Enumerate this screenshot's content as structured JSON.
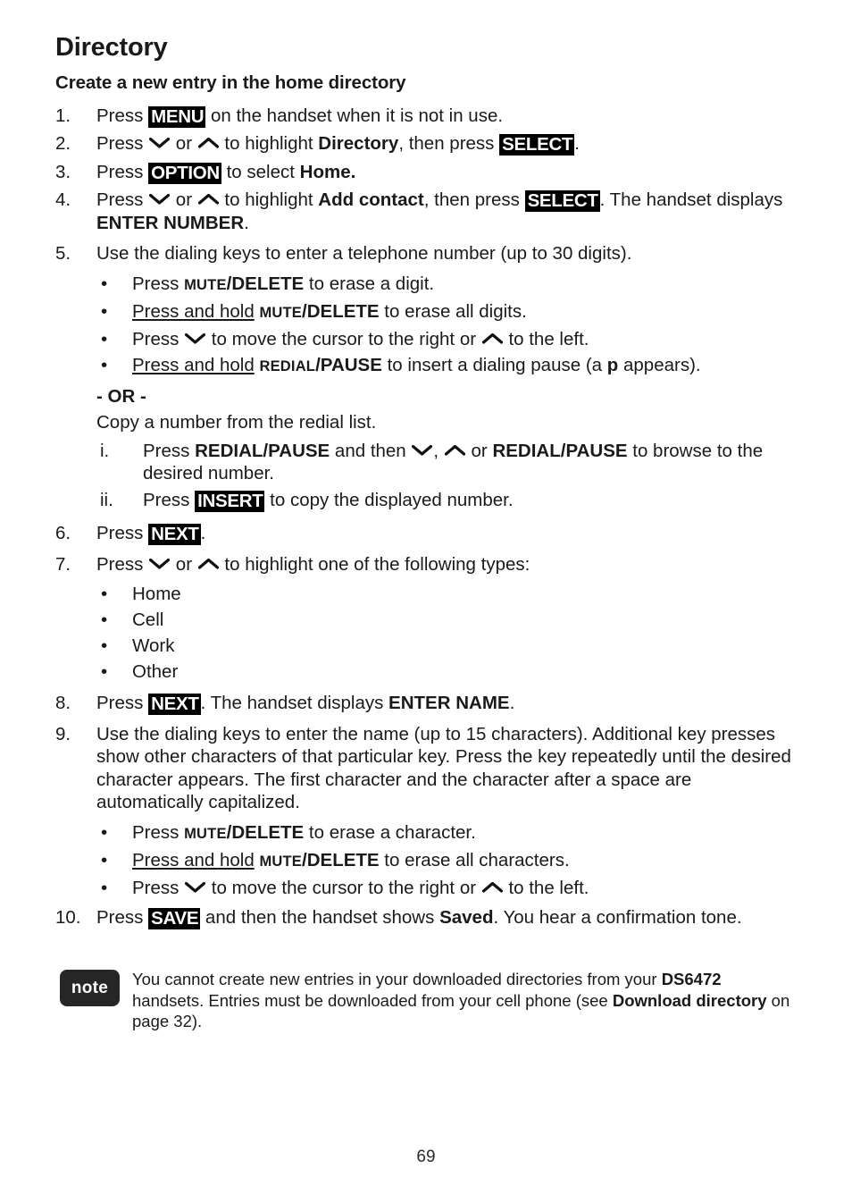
{
  "page": {
    "title": "Directory",
    "subtitle": "Create a new entry in the home directory",
    "page_number": "69"
  },
  "icons": {
    "down_chevron": "down-chevron-icon",
    "up_chevron": "up-chevron-icon"
  },
  "steps": {
    "s1": {
      "num": "1.",
      "pre": "Press ",
      "key": "MENU",
      "post": " on the handset when it is not in use."
    },
    "s2": {
      "num": "2.",
      "pre": "Press ",
      "mid_or": " or ",
      "mid": " to highlight ",
      "bold": "Directory",
      "mid2": ", then press ",
      "key": "SELECT",
      "post": "."
    },
    "s3": {
      "num": "3.",
      "pre": "Press ",
      "key": "OPTION",
      "mid": " to select ",
      "bold": "Home."
    },
    "s4": {
      "num": "4.",
      "pre": "Press ",
      "mid_or": " or ",
      "mid": " to highlight ",
      "bold": "Add contact",
      "mid2": ", then press ",
      "key": "SELECT",
      "post": ". The handset displays ",
      "bold2": "ENTER NUMBER",
      "post2": "."
    },
    "s5": {
      "num": "5.",
      "text": "Use the dialing keys to enter a telephone number (up to 30 digits).",
      "bullets": [
        {
          "dot": "•",
          "pre": "Press ",
          "sc": "MUTE",
          "bold": "/DELETE",
          "post": " to erase a digit."
        },
        {
          "dot": "•",
          "u": "Press and hold",
          "pre": " ",
          "sc": "MUTE",
          "bold": "/DELETE",
          "post": " to erase all digits."
        },
        {
          "dot": "•",
          "pre": "Press ",
          "mid": " to move the cursor to the right or ",
          "post": " to the left."
        },
        {
          "dot": "•",
          "u": "Press and hold",
          "pre": " ",
          "sc": "REDIAL",
          "bold": "/PAUSE",
          "post": " to insert a dialing pause (a ",
          "bold2": "p",
          "post2": " appears)."
        }
      ],
      "or_label": "- OR -",
      "or_text": "Copy a number from the redial list.",
      "roman": [
        {
          "num": "i.",
          "pre": "Press ",
          "bold": "REDIAL/PAUSE",
          "mid": " and then ",
          "sep": ", ",
          "mid2": " or ",
          "bold2": "REDIAL/PAUSE",
          "post": " to browse to the desired number."
        },
        {
          "num": "ii.",
          "pre": "Press ",
          "key": "INSERT",
          "post": " to copy the displayed number."
        }
      ]
    },
    "s6": {
      "num": "6.",
      "pre": "Press ",
      "key": "NEXT",
      "post": "."
    },
    "s7": {
      "num": "7.",
      "pre": "Press ",
      "mid_or": " or ",
      "post": " to highlight one of the following types:",
      "types": [
        "Home",
        "Cell",
        "Work",
        "Other"
      ],
      "dot": "•"
    },
    "s8": {
      "num": "8.",
      "pre": "Press ",
      "key": "NEXT",
      "mid": ". The handset displays ",
      "bold": "ENTER NAME",
      "post": "."
    },
    "s9": {
      "num": "9.",
      "text": "Use the dialing keys to enter the name (up to 15 characters). Additional key presses show other characters of that particular key. Press the key repeatedly until the desired character appears. The first character and the character after a space are automatically capitalized.",
      "bullets": [
        {
          "dot": "•",
          "pre": "Press ",
          "sc": "MUTE",
          "bold": "/DELETE",
          "post": " to erase a character."
        },
        {
          "dot": "•",
          "u": "Press and hold",
          "pre": " ",
          "sc": "MUTE",
          "bold": "/DELETE",
          "post": " to erase all characters."
        },
        {
          "dot": "•",
          "pre": "Press ",
          "mid": " to move the cursor to the right or ",
          "post": " to the left."
        }
      ]
    },
    "s10": {
      "num": "10.",
      "pre": "Press ",
      "key": "SAVE",
      "mid": " and then the handset shows ",
      "bold": "Saved",
      "post": ". You hear a confirmation tone."
    }
  },
  "note": {
    "badge": "note",
    "line1": "You cannot create new entries in your downloaded directories from your ",
    "bold1": "DS6472",
    "line2": " handsets. Entries must be downloaded from your cell phone (see ",
    "bold2": "Download directory",
    "line3": " on page 32)."
  }
}
